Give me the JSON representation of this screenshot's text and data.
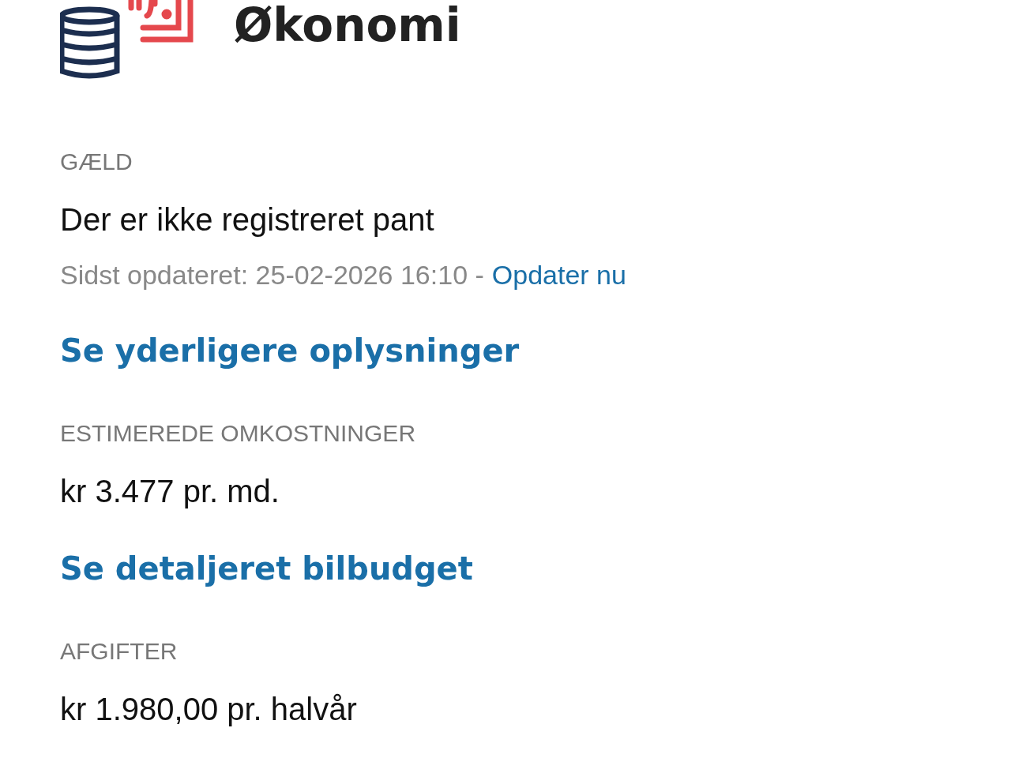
{
  "header": {
    "title": "Økonomi"
  },
  "sections": [
    {
      "kind": "status",
      "label": "GÆLD",
      "value": "Der er ikke registreret pant",
      "updated": "Sidst opdateret: 25-02-2026 16:10 -",
      "update_link": "Opdater nu",
      "link": "Se yderligere oplysninger"
    },
    {
      "kind": "plain",
      "label": "ESTIMEREDE OMKOSTNINGER",
      "value": "kr 3.477 pr. md.",
      "link": "Se detaljeret bilbudget"
    },
    {
      "kind": "plain",
      "label": "AFGIFTER",
      "value": "kr 1.980,00 pr. halvår"
    }
  ]
}
